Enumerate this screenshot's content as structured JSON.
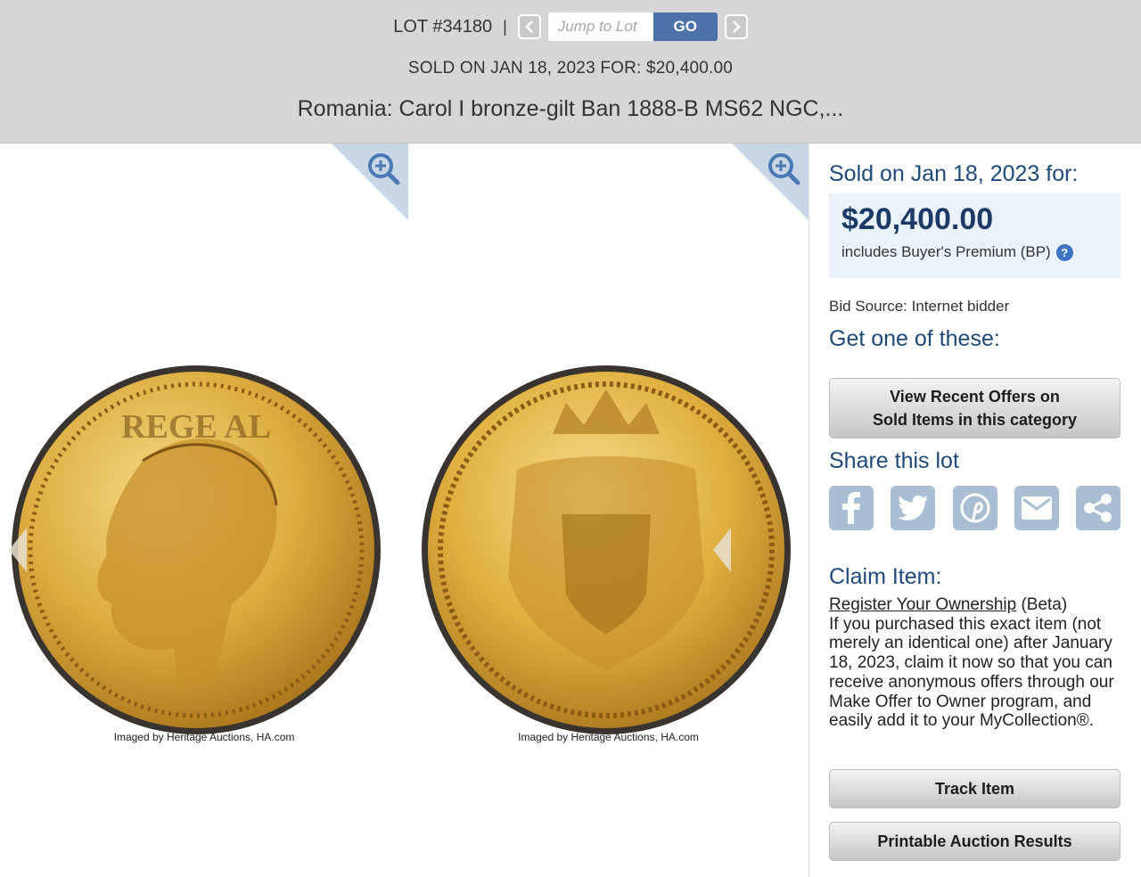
{
  "header": {
    "lot_number": "LOT #34180",
    "separator": "|",
    "jump_placeholder": "Jump to Lot",
    "go_label": "GO",
    "sold_line": "SOLD ON JAN 18, 2023 FOR: $20,400.00",
    "title": "Romania: Carol I bronze-gilt Ban 1888-B MS62 NGC,..."
  },
  "images": [
    {
      "credit": "Imaged by Heritage Auctions, HA.com"
    },
    {
      "credit": "Imaged by Heritage Auctions, HA.com"
    }
  ],
  "sidebar": {
    "sold_heading": "Sold on Jan 18, 2023 for:",
    "price": "$20,400.00",
    "bp_note": "includes Buyer's Premium (BP)",
    "help_icon": "?",
    "bid_source": "Bid Source: Internet bidder",
    "get_heading": "Get one of these:",
    "view_offers_line1": "View Recent Offers on",
    "view_offers_line2": "Sold Items in this category",
    "share_heading": "Share this lot",
    "share_icons": [
      "facebook-icon",
      "twitter-icon",
      "pinterest-icon",
      "email-icon",
      "share-icon"
    ],
    "claim_heading": "Claim Item:",
    "register_link": "Register Your Ownership",
    "register_suffix": " (Beta)",
    "claim_body": "If you purchased this exact item (not merely an identical one) after January 18, 2023, claim it now so that you can receive anonymous offers through our Make Offer to Owner program, and easily add it to your MyCollection®.",
    "track_label": "Track Item",
    "print_label": "Printable Auction Results"
  },
  "colors": {
    "header_bg": "#d6d6d6",
    "accent_blue": "#1e4a79",
    "go_button": "#4c72a9",
    "price_box": "#eaf3fb",
    "share_icon_bg": "#a9bdd3",
    "coin_gold": "#d9a836"
  }
}
